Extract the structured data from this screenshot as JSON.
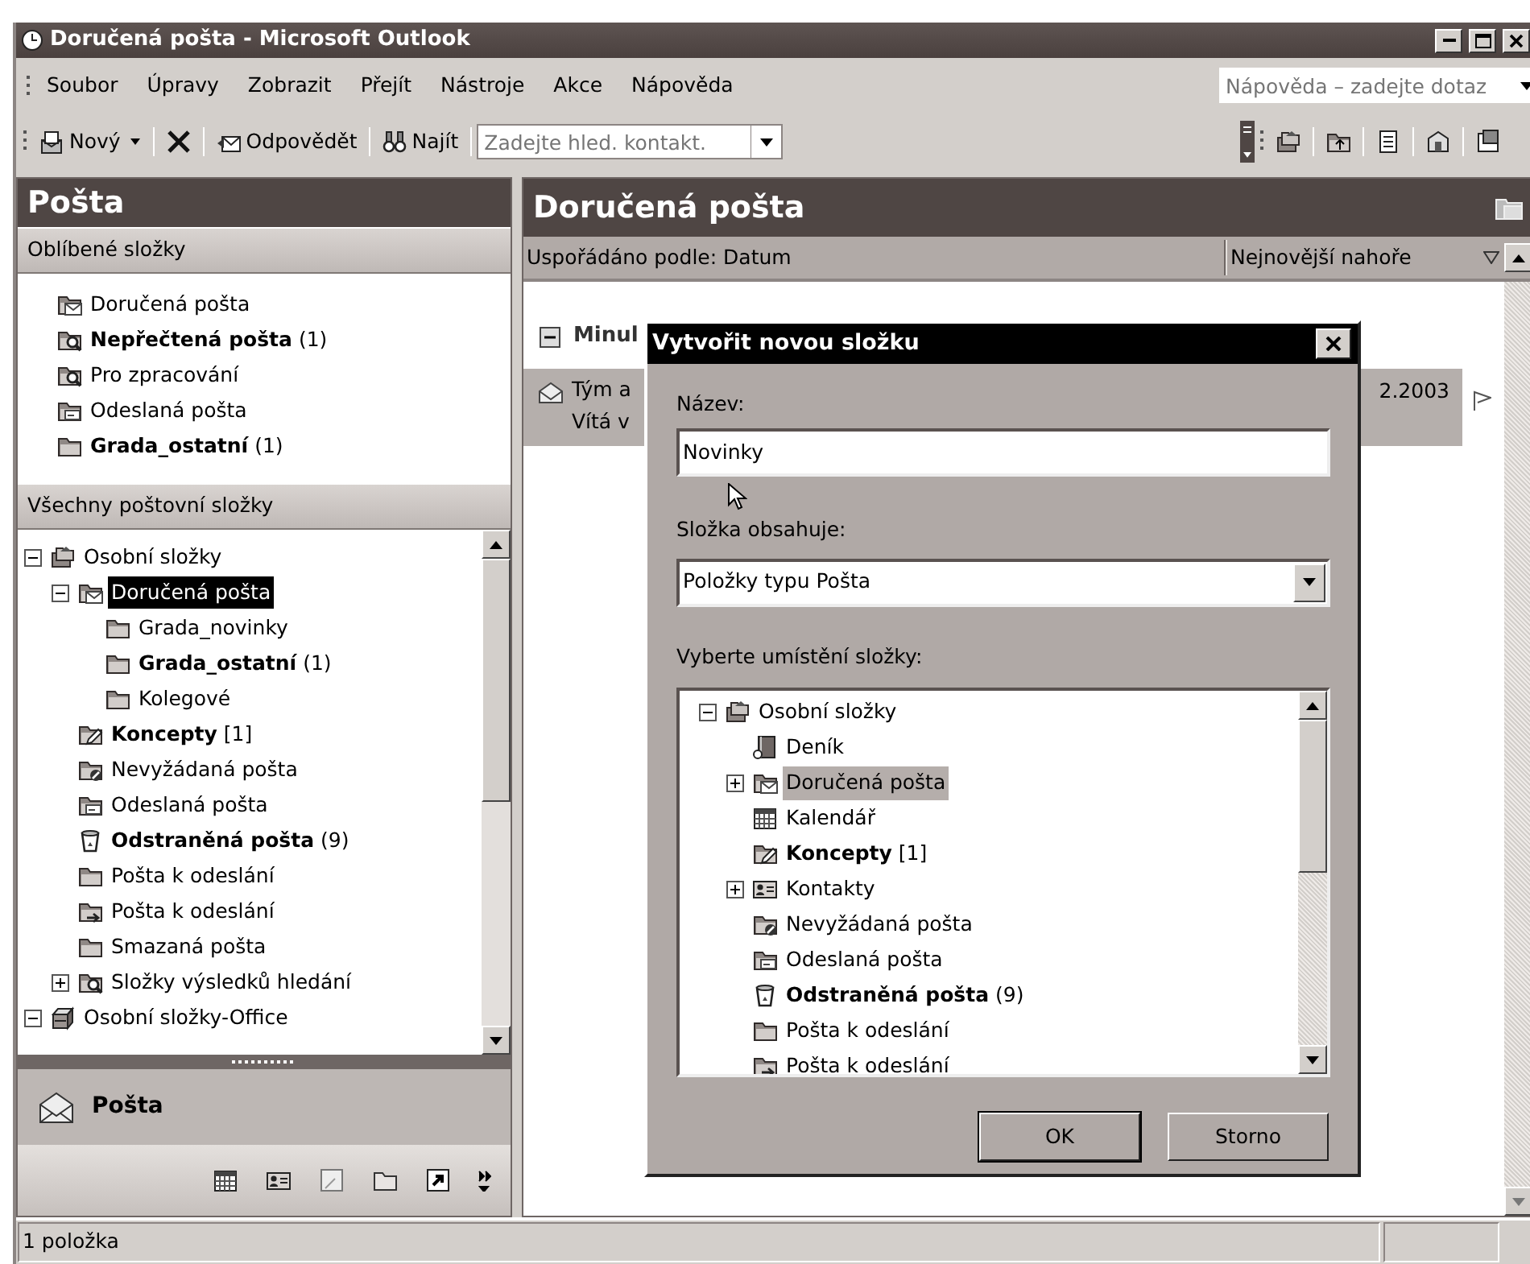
{
  "window": {
    "title": "Doručená pošta - Microsoft Outlook"
  },
  "menu": [
    "Soubor",
    "Úpravy",
    "Zobrazit",
    "Přejít",
    "Nástroje",
    "Akce",
    "Nápověda"
  ],
  "help_search": {
    "placeholder": "Nápověda – zadejte dotaz"
  },
  "toolbar": [
    {
      "kind": "new",
      "label": "Nový"
    },
    {
      "kind": "delete"
    },
    {
      "kind": "reply",
      "label": "Odpovědět"
    },
    {
      "kind": "find",
      "label": "Najít"
    },
    {
      "kind": "combo",
      "placeholder": "Zadejte hled. kontakt."
    }
  ],
  "folder_pane": {
    "title": "Pošta",
    "favorites_header": "Oblíbené složky",
    "favorites": [
      {
        "label": "Doručená pošta",
        "kind": "inbox",
        "unread": false,
        "selected": false
      },
      {
        "label": "Nepřečtená pošta",
        "count": "(1)",
        "kind": "search",
        "unread": true,
        "selected": false
      },
      {
        "label": "Pro zpracování",
        "kind": "search",
        "unread": false,
        "selected": false
      },
      {
        "label": "Odeslaná pošta",
        "kind": "sent",
        "unread": false,
        "selected": false
      },
      {
        "label": "Grada_ostatní",
        "count": "(1)",
        "kind": "folder",
        "unread": true,
        "selected": false
      }
    ],
    "all_header": "Všechny poštovní složky",
    "tree": [
      {
        "label": "Osobní složky",
        "kind": "store",
        "unread": false,
        "selected": false,
        "expanded": true,
        "children": [
          {
            "label": "Doručená pošta",
            "kind": "inbox",
            "unread": false,
            "selected": true,
            "expanded": true,
            "children": [
              {
                "label": "Grada_novinky",
                "kind": "folder",
                "unread": false,
                "selected": false
              },
              {
                "label": "Grada_ostatní",
                "count": "(1)",
                "kind": "folder",
                "unread": true,
                "selected": false
              },
              {
                "label": "Kolegové",
                "kind": "folder",
                "unread": false,
                "selected": false
              }
            ]
          },
          {
            "label": "Koncepty",
            "count": "[1]",
            "kind": "drafts",
            "unread": true,
            "selected": false
          },
          {
            "label": "Nevyžádaná pošta",
            "kind": "junk",
            "unread": false,
            "selected": false
          },
          {
            "label": "Odeslaná pošta",
            "kind": "sent",
            "unread": false,
            "selected": false
          },
          {
            "label": "Odstraněná pošta",
            "count": "(9)",
            "kind": "deleted",
            "unread": true,
            "selected": false
          },
          {
            "label": "Pošta k odeslání",
            "kind": "folder",
            "unread": false,
            "selected": false
          },
          {
            "label": "Pošta k odeslání",
            "kind": "outbox",
            "unread": false,
            "selected": false
          },
          {
            "label": "Smazaná pošta",
            "kind": "folder",
            "unread": false,
            "selected": false
          },
          {
            "label": "Složky výsledků hledání",
            "kind": "search",
            "unread": false,
            "selected": false,
            "expanded": false
          }
        ]
      },
      {
        "label": "Osobní složky-Office",
        "kind": "archive",
        "unread": false,
        "selected": false,
        "expanded": true
      }
    ],
    "nav_button": "Pošta"
  },
  "message_pane": {
    "title": "Doručená pošta",
    "arrange_by": "Uspořádáno podle: Datum",
    "sort_order": "Nejnovější nahoře",
    "group": {
      "label": "Minul",
      "expanded": true
    },
    "message": {
      "from": "Tým a",
      "preview": "Vítá v",
      "date": "2.2003",
      "selected": true
    }
  },
  "dialog": {
    "title": "Vytvořit novou složku",
    "name_label": "Název:",
    "name_value": "Novinky",
    "contains_label": "Složka obsahuje:",
    "contains_value": "Položky typu Pošta",
    "location_label": "Vyberte umístění složky:",
    "tree": [
      {
        "label": "Osobní složky",
        "kind": "store",
        "unread": false,
        "selected": false,
        "expanded": true,
        "children": [
          {
            "label": "Deník",
            "kind": "journal",
            "unread": false,
            "selected": false
          },
          {
            "label": "Doručená pošta",
            "kind": "inbox",
            "unread": false,
            "selected": true,
            "expanded": false
          },
          {
            "label": "Kalendář",
            "kind": "calendar",
            "unread": false,
            "selected": false
          },
          {
            "label": "Koncepty",
            "count": "[1]",
            "kind": "drafts",
            "unread": true,
            "selected": false
          },
          {
            "label": "Kontakty",
            "kind": "contacts",
            "unread": false,
            "selected": false,
            "expanded": false
          },
          {
            "label": "Nevyžádaná pošta",
            "kind": "junk",
            "unread": false,
            "selected": false
          },
          {
            "label": "Odeslaná pošta",
            "kind": "sent",
            "unread": false,
            "selected": false
          },
          {
            "label": "Odstraněná pošta",
            "count": "(9)",
            "kind": "deleted",
            "unread": true,
            "selected": false
          },
          {
            "label": "Pošta k odeslání",
            "kind": "folder",
            "unread": false,
            "selected": false
          },
          {
            "label": "Pošta k odeslání",
            "kind": "outbox",
            "unread": false,
            "selected": false
          }
        ]
      }
    ],
    "buttons": [
      {
        "label": "OK",
        "default": true
      },
      {
        "label": "Storno",
        "default": false
      }
    ]
  },
  "status_bar": "1 položka"
}
